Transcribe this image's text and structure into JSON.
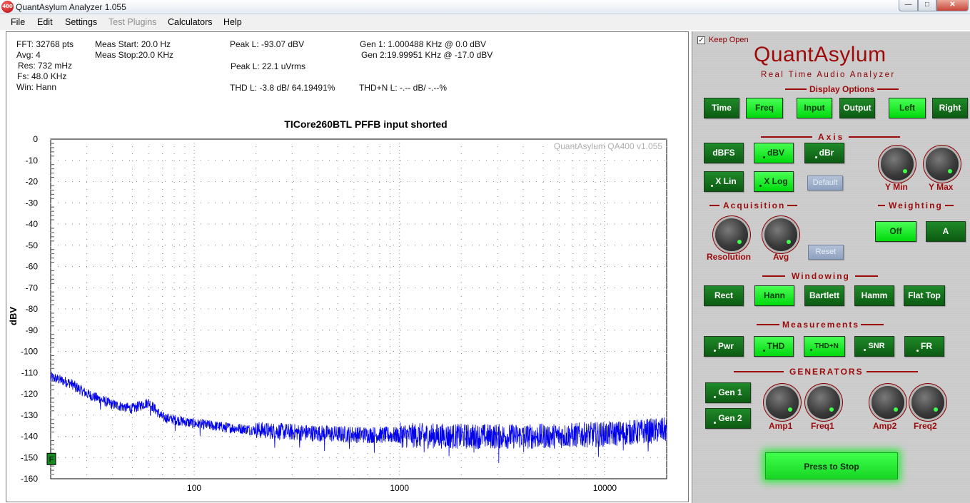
{
  "window": {
    "title": "QuantAsylum Analyzer 1.055",
    "icon_text": "400"
  },
  "menu": [
    "File",
    "Edit",
    "Settings",
    "Test Plugins",
    "Calculators",
    "Help"
  ],
  "menu_disabled": [
    "Test Plugins"
  ],
  "readouts": {
    "fft": "FFT: 32768 pts",
    "avg": "Avg: 4",
    "res": "Res: 732 mHz",
    "fs": "Fs: 48.0 KHz",
    "win": "Win: Hann",
    "meas_start": "Meas Start: 20.0 Hz",
    "meas_stop": "Meas Stop:20.0 KHz",
    "peak_dbv": "Peak L: -93.07 dBV",
    "peak_vrms": "Peak L: 22.1 uVrms",
    "thd": "THD L: -3.8 dB/ 64.19491%",
    "thdn": "THD+N L: -.-- dB/ -.--%",
    "gen1": "Gen 1: 1.000488 KHz @ 0.0  dBV",
    "gen2": "Gen 2:19.99951 KHz @ -17.0  dBV"
  },
  "chart_data": {
    "type": "line",
    "title": "TICore260BTL PFFB input shorted",
    "watermark": "QuantAsylum QA400 v1.055",
    "ylabel": "dBV",
    "xlabel": "",
    "x_scale": "log",
    "xlim": [
      20,
      20000
    ],
    "ylim": [
      -160,
      0
    ],
    "y_ticks": [
      0,
      -10,
      -20,
      -30,
      -40,
      -50,
      -60,
      -70,
      -80,
      -90,
      -100,
      -110,
      -120,
      -130,
      -140,
      -150,
      -160
    ],
    "x_tick_labels": [
      "100",
      "1000",
      "10000"
    ],
    "grid": true,
    "marker_label": "F",
    "series": [
      {
        "color": "#0000ee",
        "noise_floor_profile": {
          "x": [
            20,
            25,
            30,
            40,
            50,
            60,
            70,
            100,
            150,
            200,
            300,
            500,
            1000,
            2000,
            5000,
            10000,
            20000
          ],
          "y": [
            -112,
            -115,
            -120,
            -125,
            -127,
            -124,
            -131,
            -134,
            -136,
            -137,
            -138,
            -139,
            -139.5,
            -140,
            -140,
            -139,
            -137
          ]
        }
      }
    ]
  },
  "panel": {
    "keep_open_label": "Keep Open",
    "keep_open_checked": true,
    "brand": "QuantAsylum",
    "brand_sub": "Real Time Audio Analyzer",
    "sections": {
      "display": "Display Options",
      "axis": "Axis",
      "acquisition": "Acquisition",
      "weighting": "Weighting",
      "windowing": "Windowing",
      "measurements": "Measurements",
      "generators": "GENERATORS"
    },
    "display_buttons": [
      "Time",
      "Freq",
      "Input",
      "Output",
      "Left",
      "Right"
    ],
    "axis_buttons": [
      "dBFS",
      "dBV",
      "dBr",
      "X Lin",
      "X Log",
      "Default"
    ],
    "axis_knobs": [
      "Y Min",
      "Y Max"
    ],
    "acq_knobs": [
      "Resolution",
      "Avg"
    ],
    "acq_reset": "Reset",
    "weighting_buttons": [
      "Off",
      "A"
    ],
    "window_buttons": [
      "Rect",
      "Hann",
      "Bartlett",
      "Hamm",
      "Flat Top"
    ],
    "meas_buttons": [
      "Pwr",
      "THD",
      "THD+N",
      "SNR",
      "FR"
    ],
    "gen_buttons": [
      "Gen 1",
      "Gen 2"
    ],
    "gen_knobs": [
      "Amp1",
      "Freq1",
      "Amp2",
      "Freq2"
    ],
    "stop_button": "Press to Stop",
    "accent_color": "#9c0a0a",
    "active_color": "#00e010"
  }
}
